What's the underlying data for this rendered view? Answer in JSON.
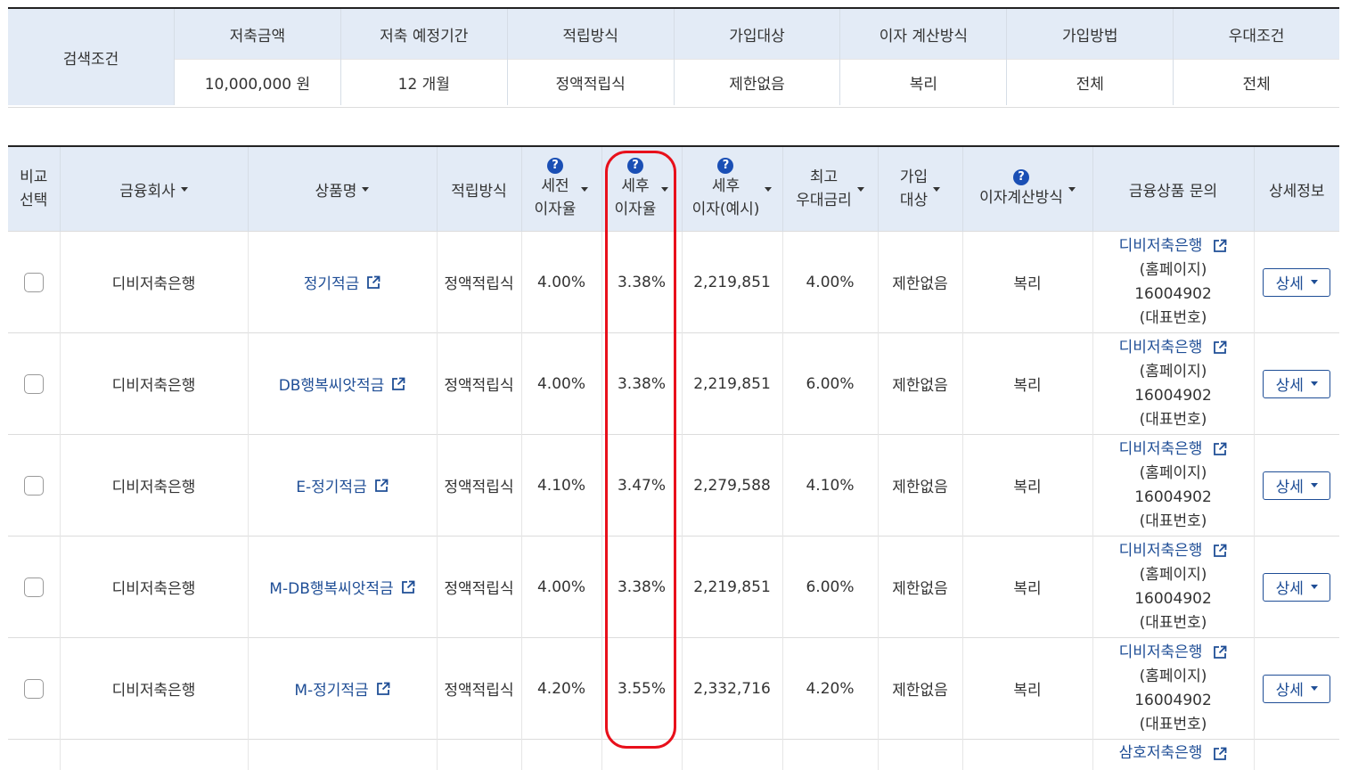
{
  "conditions": {
    "label": "검색조건",
    "columns": [
      {
        "header": "저축금액",
        "value": "10,000,000 원"
      },
      {
        "header": "저축 예정기간",
        "value": "12 개월"
      },
      {
        "header": "적립방식",
        "value": "정액적립식"
      },
      {
        "header": "가입대상",
        "value": "제한없음"
      },
      {
        "header": "이자 계산방식",
        "value": "복리"
      },
      {
        "header": "가입방법",
        "value": "전체"
      },
      {
        "header": "우대조건",
        "value": "전체"
      }
    ]
  },
  "table": {
    "headers": {
      "compare": [
        "비교",
        "선택"
      ],
      "company": "금융회사",
      "product": "상품명",
      "method": "적립방식",
      "pretax": [
        "세전",
        "이자율"
      ],
      "aftertax": [
        "세후",
        "이자율"
      ],
      "interest": [
        "세후",
        "이자(예시)"
      ],
      "maxrate": [
        "최고",
        "우대금리"
      ],
      "target": [
        "가입",
        "대상"
      ],
      "calc": "이자계산방식",
      "inquiry": "금융상품 문의",
      "detail": "상세정보"
    },
    "rows": [
      {
        "company": "디비저축은행",
        "product": "정기적금",
        "method": "정액적립식",
        "pretax": "4.00%",
        "aftertax": "3.38%",
        "interest": "2,219,851",
        "maxrate": "4.00%",
        "target": "제한없음",
        "calc": "복리",
        "inq_bank": "디비저축은행",
        "inq_home": "(홈페이지)",
        "inq_phone": "16004902",
        "inq_rep": "(대표번호)",
        "detail": "상세"
      },
      {
        "company": "디비저축은행",
        "product": "DB행복씨앗적금",
        "method": "정액적립식",
        "pretax": "4.00%",
        "aftertax": "3.38%",
        "interest": "2,219,851",
        "maxrate": "6.00%",
        "target": "제한없음",
        "calc": "복리",
        "inq_bank": "디비저축은행",
        "inq_home": "(홈페이지)",
        "inq_phone": "16004902",
        "inq_rep": "(대표번호)",
        "detail": "상세"
      },
      {
        "company": "디비저축은행",
        "product": "E-정기적금",
        "method": "정액적립식",
        "pretax": "4.10%",
        "aftertax": "3.47%",
        "interest": "2,279,588",
        "maxrate": "4.10%",
        "target": "제한없음",
        "calc": "복리",
        "inq_bank": "디비저축은행",
        "inq_home": "(홈페이지)",
        "inq_phone": "16004902",
        "inq_rep": "(대표번호)",
        "detail": "상세"
      },
      {
        "company": "디비저축은행",
        "product": "M-DB행복씨앗적금",
        "method": "정액적립식",
        "pretax": "4.00%",
        "aftertax": "3.38%",
        "interest": "2,219,851",
        "maxrate": "6.00%",
        "target": "제한없음",
        "calc": "복리",
        "inq_bank": "디비저축은행",
        "inq_home": "(홈페이지)",
        "inq_phone": "16004902",
        "inq_rep": "(대표번호)",
        "detail": "상세"
      },
      {
        "company": "디비저축은행",
        "product": "M-정기적금",
        "method": "정액적립식",
        "pretax": "4.20%",
        "aftertax": "3.55%",
        "interest": "2,332,716",
        "maxrate": "4.20%",
        "target": "제한없음",
        "calc": "복리",
        "inq_bank": "디비저축은행",
        "inq_home": "(홈페이지)",
        "inq_phone": "16004902",
        "inq_rep": "(대표번호)",
        "detail": "상세"
      }
    ],
    "partial_row": {
      "inq_bank": "삼호저축은행"
    }
  },
  "icons": {
    "help": "question-circle-icon",
    "sort": "caret-down-icon",
    "external": "external-link-icon"
  },
  "colors": {
    "header_bg": "#e3ebf6",
    "link": "#1f4e96",
    "help_icon": "#1a4fb5",
    "highlight": "#e8101b"
  }
}
